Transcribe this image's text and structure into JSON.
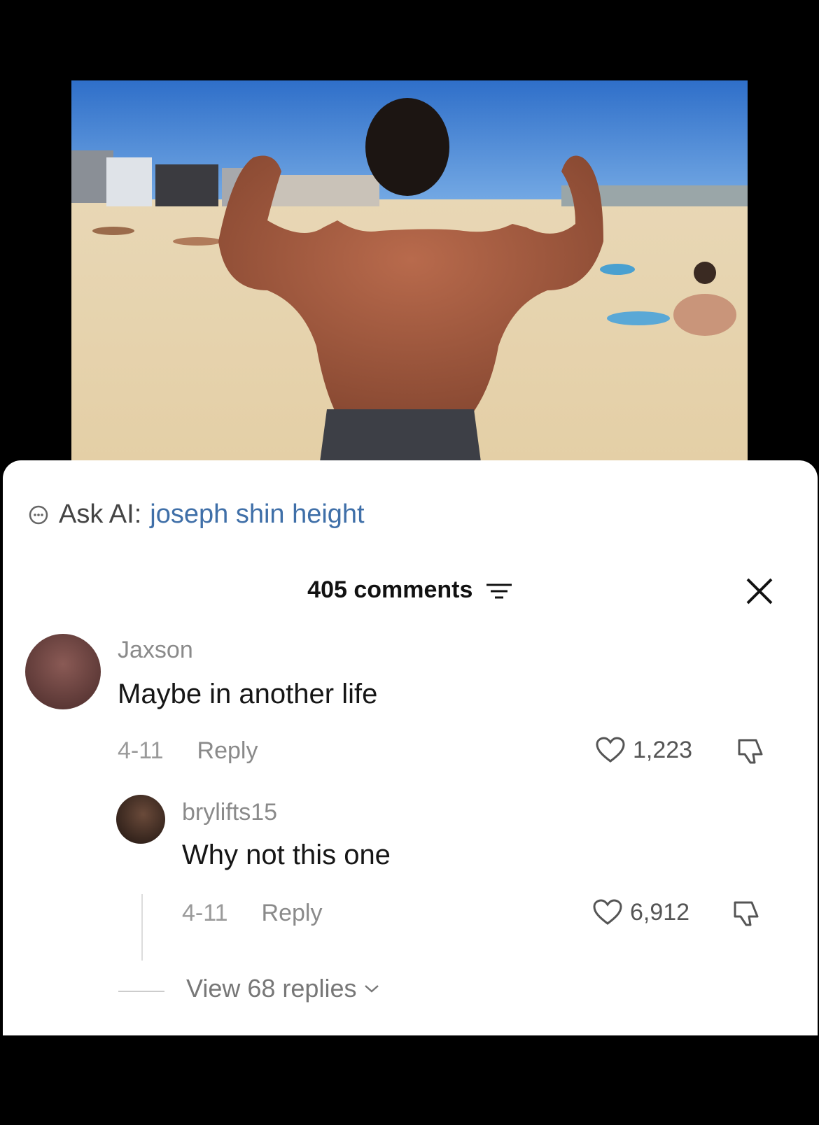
{
  "photo": {
    "description_icon": "beach-photo"
  },
  "ask_ai": {
    "label": "Ask AI:",
    "query": "joseph shin height",
    "icon": "ai-chat-icon"
  },
  "comments_header": {
    "count_label": "405 comments",
    "filter_icon": "filter-icon",
    "close_icon": "close-icon"
  },
  "comments": [
    {
      "username": "Jaxson",
      "text": "Maybe in another life",
      "date": "4-11",
      "reply_label": "Reply",
      "likes": "1,223"
    },
    {
      "username": "brylifts15",
      "text": "Why not this one",
      "date": "4-11",
      "reply_label": "Reply",
      "likes": "6,912"
    }
  ],
  "view_replies": "View 68 replies",
  "colors": {
    "link": "#3f6fa8",
    "sheet_bg": "#ffffff",
    "outer_bg": "#000000"
  }
}
